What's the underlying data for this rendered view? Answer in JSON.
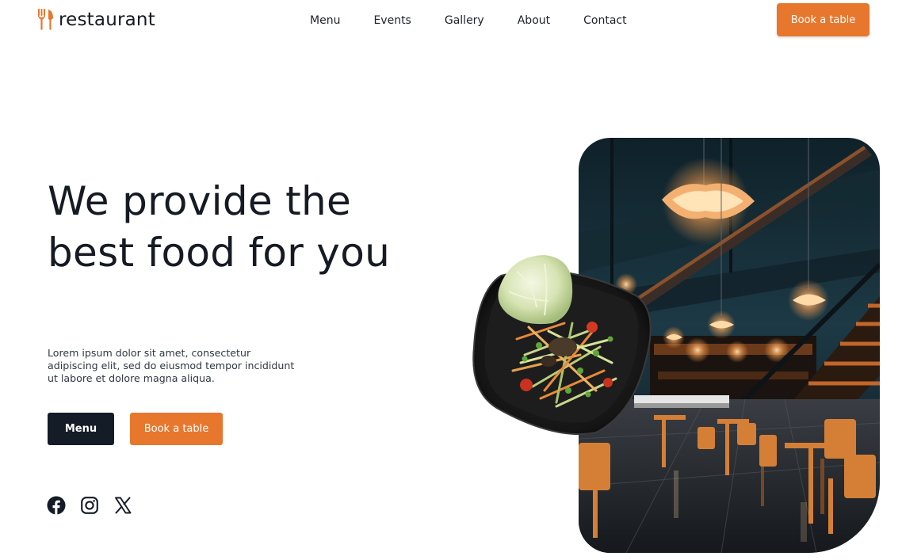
{
  "brand": {
    "name": "restaurant",
    "icon": "fork-knife-icon",
    "accent_color": "#e8772e",
    "dark_color": "#141c27"
  },
  "nav": {
    "items": [
      {
        "label": "Menu"
      },
      {
        "label": "Events"
      },
      {
        "label": "Gallery"
      },
      {
        "label": "About"
      },
      {
        "label": "Contact"
      }
    ],
    "cta_label": "Book a table"
  },
  "hero": {
    "title_line1": "We provide the",
    "title_line2": "best food for you",
    "description": "Lorem ipsum dolor sit amet, consectetur adipiscing elit, sed do eiusmod tempor incididunt ut labore et dolore magna aliqua.",
    "menu_button": "Menu",
    "book_button": "Book a table"
  },
  "social": {
    "icons": [
      "facebook-icon",
      "instagram-icon",
      "x-icon"
    ]
  },
  "images": {
    "interior": "restaurant-interior-photo",
    "dish": "salad-plate-photo"
  }
}
